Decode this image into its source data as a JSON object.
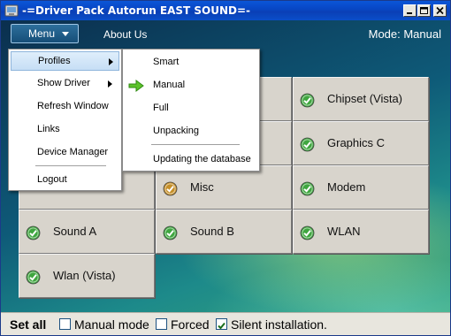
{
  "window": {
    "title": "-=Driver Pack Autorun EAST SOUND=-"
  },
  "topbar": {
    "menu_label": "Menu",
    "about_label": "About Us",
    "mode_text": "Mode: Manual"
  },
  "tiles": [
    {
      "label": "Chipset (Vista)",
      "status": "ok"
    },
    {
      "label": "Graphics C",
      "status": "ok"
    },
    {
      "label": "Misc",
      "status": "warning"
    },
    {
      "label": "Modem",
      "status": "ok"
    },
    {
      "label": "Sound A",
      "status": "ok"
    },
    {
      "label": "Sound B",
      "status": "ok"
    },
    {
      "label": "WLAN",
      "status": "ok"
    },
    {
      "label": "Wlan (Vista)",
      "status": "ok"
    }
  ],
  "main_menu": {
    "items": [
      {
        "label": "Profiles",
        "has_submenu": true,
        "highlighted": true
      },
      {
        "label": "Show Driver",
        "has_submenu": true
      },
      {
        "label": "Refresh Window"
      },
      {
        "label": "Links"
      },
      {
        "label": "Device Manager"
      },
      {
        "label": "Logout"
      }
    ]
  },
  "profiles_submenu": {
    "items": [
      {
        "label": "Smart"
      },
      {
        "label": "Manual",
        "selected": true
      },
      {
        "label": "Full"
      },
      {
        "label": "Unpacking"
      },
      {
        "label": "Updating the database"
      }
    ]
  },
  "bottom_bar": {
    "set_all_label": "Set all",
    "options": [
      {
        "label": "Manual mode",
        "checked": false
      },
      {
        "label": "Forced",
        "checked": false
      },
      {
        "label": "Silent installation.",
        "checked": true
      }
    ]
  },
  "colors": {
    "title_bar": "#0a4ec9",
    "tile_face": "#d8d4cc",
    "ok_check": "#3fa63f",
    "warning_check": "#c6902a",
    "selected_arrow": "#5cc32a"
  },
  "icons": {
    "ok": "green-check-circle",
    "warning": "orange-check-circle",
    "selected": "green-right-arrow",
    "submenu": "right-triangle"
  }
}
